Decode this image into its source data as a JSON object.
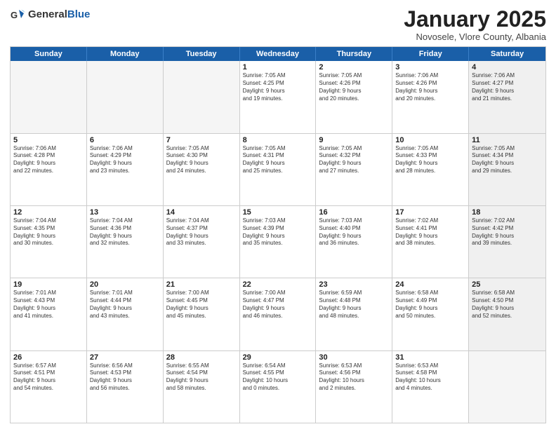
{
  "header": {
    "logo_general": "General",
    "logo_blue": "Blue",
    "month": "January 2025",
    "location": "Novosele, Vlore County, Albania"
  },
  "weekdays": [
    "Sunday",
    "Monday",
    "Tuesday",
    "Wednesday",
    "Thursday",
    "Friday",
    "Saturday"
  ],
  "rows": [
    [
      {
        "day": "",
        "text": "",
        "empty": true
      },
      {
        "day": "",
        "text": "",
        "empty": true
      },
      {
        "day": "",
        "text": "",
        "empty": true
      },
      {
        "day": "1",
        "text": "Sunrise: 7:05 AM\nSunset: 4:25 PM\nDaylight: 9 hours\nand 19 minutes."
      },
      {
        "day": "2",
        "text": "Sunrise: 7:05 AM\nSunset: 4:26 PM\nDaylight: 9 hours\nand 20 minutes."
      },
      {
        "day": "3",
        "text": "Sunrise: 7:06 AM\nSunset: 4:26 PM\nDaylight: 9 hours\nand 20 minutes."
      },
      {
        "day": "4",
        "text": "Sunrise: 7:06 AM\nSunset: 4:27 PM\nDaylight: 9 hours\nand 21 minutes.",
        "shaded": true
      }
    ],
    [
      {
        "day": "5",
        "text": "Sunrise: 7:06 AM\nSunset: 4:28 PM\nDaylight: 9 hours\nand 22 minutes."
      },
      {
        "day": "6",
        "text": "Sunrise: 7:06 AM\nSunset: 4:29 PM\nDaylight: 9 hours\nand 23 minutes."
      },
      {
        "day": "7",
        "text": "Sunrise: 7:05 AM\nSunset: 4:30 PM\nDaylight: 9 hours\nand 24 minutes."
      },
      {
        "day": "8",
        "text": "Sunrise: 7:05 AM\nSunset: 4:31 PM\nDaylight: 9 hours\nand 25 minutes."
      },
      {
        "day": "9",
        "text": "Sunrise: 7:05 AM\nSunset: 4:32 PM\nDaylight: 9 hours\nand 27 minutes."
      },
      {
        "day": "10",
        "text": "Sunrise: 7:05 AM\nSunset: 4:33 PM\nDaylight: 9 hours\nand 28 minutes."
      },
      {
        "day": "11",
        "text": "Sunrise: 7:05 AM\nSunset: 4:34 PM\nDaylight: 9 hours\nand 29 minutes.",
        "shaded": true
      }
    ],
    [
      {
        "day": "12",
        "text": "Sunrise: 7:04 AM\nSunset: 4:35 PM\nDaylight: 9 hours\nand 30 minutes."
      },
      {
        "day": "13",
        "text": "Sunrise: 7:04 AM\nSunset: 4:36 PM\nDaylight: 9 hours\nand 32 minutes."
      },
      {
        "day": "14",
        "text": "Sunrise: 7:04 AM\nSunset: 4:37 PM\nDaylight: 9 hours\nand 33 minutes."
      },
      {
        "day": "15",
        "text": "Sunrise: 7:03 AM\nSunset: 4:39 PM\nDaylight: 9 hours\nand 35 minutes."
      },
      {
        "day": "16",
        "text": "Sunrise: 7:03 AM\nSunset: 4:40 PM\nDaylight: 9 hours\nand 36 minutes."
      },
      {
        "day": "17",
        "text": "Sunrise: 7:02 AM\nSunset: 4:41 PM\nDaylight: 9 hours\nand 38 minutes."
      },
      {
        "day": "18",
        "text": "Sunrise: 7:02 AM\nSunset: 4:42 PM\nDaylight: 9 hours\nand 39 minutes.",
        "shaded": true
      }
    ],
    [
      {
        "day": "19",
        "text": "Sunrise: 7:01 AM\nSunset: 4:43 PM\nDaylight: 9 hours\nand 41 minutes."
      },
      {
        "day": "20",
        "text": "Sunrise: 7:01 AM\nSunset: 4:44 PM\nDaylight: 9 hours\nand 43 minutes."
      },
      {
        "day": "21",
        "text": "Sunrise: 7:00 AM\nSunset: 4:45 PM\nDaylight: 9 hours\nand 45 minutes."
      },
      {
        "day": "22",
        "text": "Sunrise: 7:00 AM\nSunset: 4:47 PM\nDaylight: 9 hours\nand 46 minutes."
      },
      {
        "day": "23",
        "text": "Sunrise: 6:59 AM\nSunset: 4:48 PM\nDaylight: 9 hours\nand 48 minutes."
      },
      {
        "day": "24",
        "text": "Sunrise: 6:58 AM\nSunset: 4:49 PM\nDaylight: 9 hours\nand 50 minutes."
      },
      {
        "day": "25",
        "text": "Sunrise: 6:58 AM\nSunset: 4:50 PM\nDaylight: 9 hours\nand 52 minutes.",
        "shaded": true
      }
    ],
    [
      {
        "day": "26",
        "text": "Sunrise: 6:57 AM\nSunset: 4:51 PM\nDaylight: 9 hours\nand 54 minutes."
      },
      {
        "day": "27",
        "text": "Sunrise: 6:56 AM\nSunset: 4:53 PM\nDaylight: 9 hours\nand 56 minutes."
      },
      {
        "day": "28",
        "text": "Sunrise: 6:55 AM\nSunset: 4:54 PM\nDaylight: 9 hours\nand 58 minutes."
      },
      {
        "day": "29",
        "text": "Sunrise: 6:54 AM\nSunset: 4:55 PM\nDaylight: 10 hours\nand 0 minutes."
      },
      {
        "day": "30",
        "text": "Sunrise: 6:53 AM\nSunset: 4:56 PM\nDaylight: 10 hours\nand 2 minutes."
      },
      {
        "day": "31",
        "text": "Sunrise: 6:53 AM\nSunset: 4:58 PM\nDaylight: 10 hours\nand 4 minutes."
      },
      {
        "day": "",
        "text": "",
        "empty": true,
        "shaded": true
      }
    ]
  ]
}
